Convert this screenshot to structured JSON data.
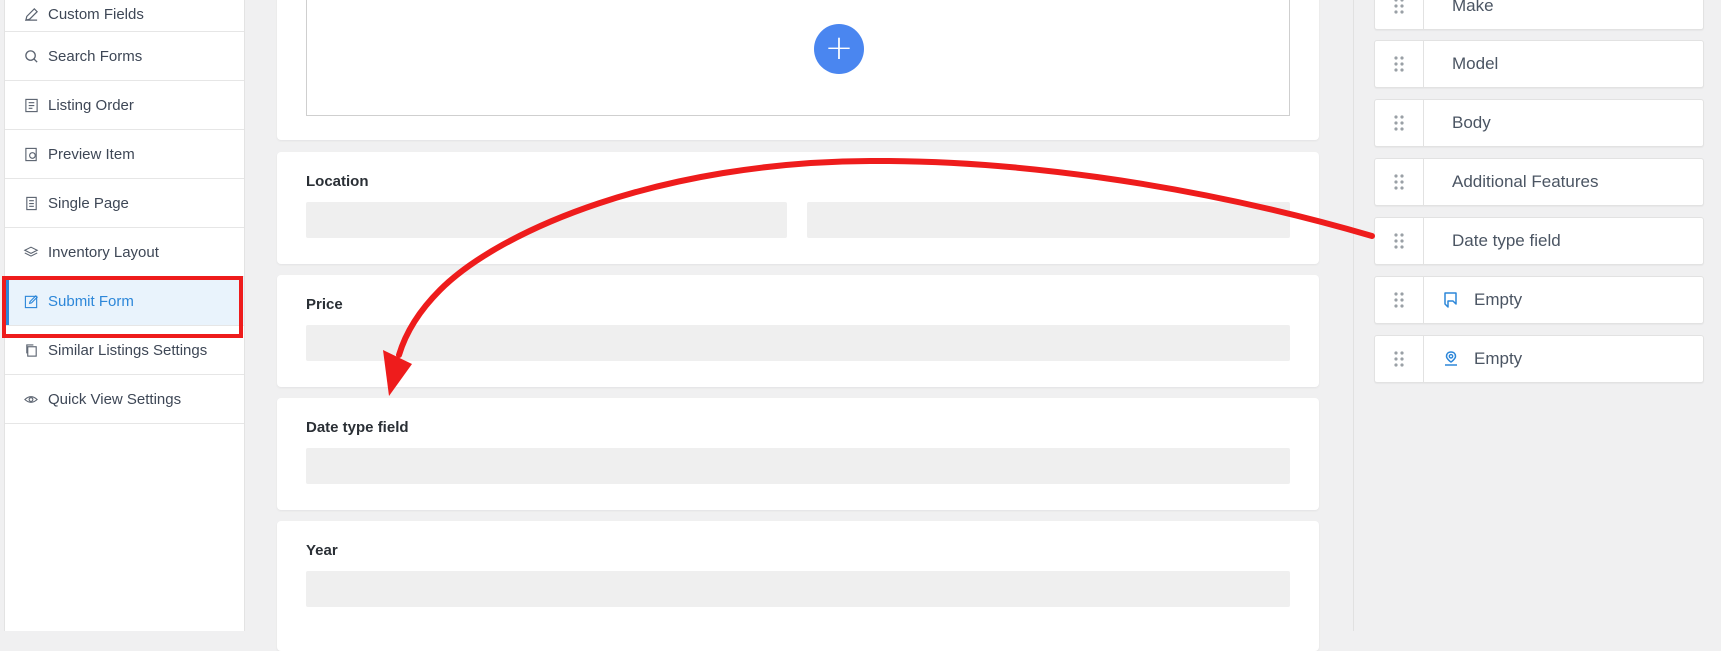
{
  "sidebar": {
    "items": [
      {
        "label": "Custom Fields",
        "icon": "pencil-icon",
        "active": false
      },
      {
        "label": "Search Forms",
        "icon": "search-icon",
        "active": false
      },
      {
        "label": "Listing Order",
        "icon": "list-order-icon",
        "active": false
      },
      {
        "label": "Preview Item",
        "icon": "preview-icon",
        "active": false
      },
      {
        "label": "Single Page",
        "icon": "page-icon",
        "active": false
      },
      {
        "label": "Inventory Layout",
        "icon": "layers-icon",
        "active": false
      },
      {
        "label": "Submit Form",
        "icon": "edit-icon",
        "active": true
      },
      {
        "label": "Similar Listings Settings",
        "icon": "copy-icon",
        "active": false
      },
      {
        "label": "Quick View Settings",
        "icon": "eye-icon",
        "active": false
      }
    ]
  },
  "builder": {
    "add_button": "+",
    "fields": [
      {
        "label": "Location"
      },
      {
        "label": "Price"
      },
      {
        "label": "Date type field"
      },
      {
        "label": "Year"
      }
    ]
  },
  "available_fields": {
    "items": [
      {
        "label": "Make",
        "icon": null
      },
      {
        "label": "Model",
        "icon": null
      },
      {
        "label": "Body",
        "icon": null
      },
      {
        "label": "Additional Features",
        "icon": null
      },
      {
        "label": "Date type field",
        "icon": null
      },
      {
        "label": "Empty",
        "icon": "bookmark-icon"
      },
      {
        "label": "Empty",
        "icon": "map-pin-icon"
      }
    ]
  },
  "colors": {
    "accent": "#2d87d9",
    "annotation": "#ee1c1c",
    "add_button": "#4a86f0"
  }
}
